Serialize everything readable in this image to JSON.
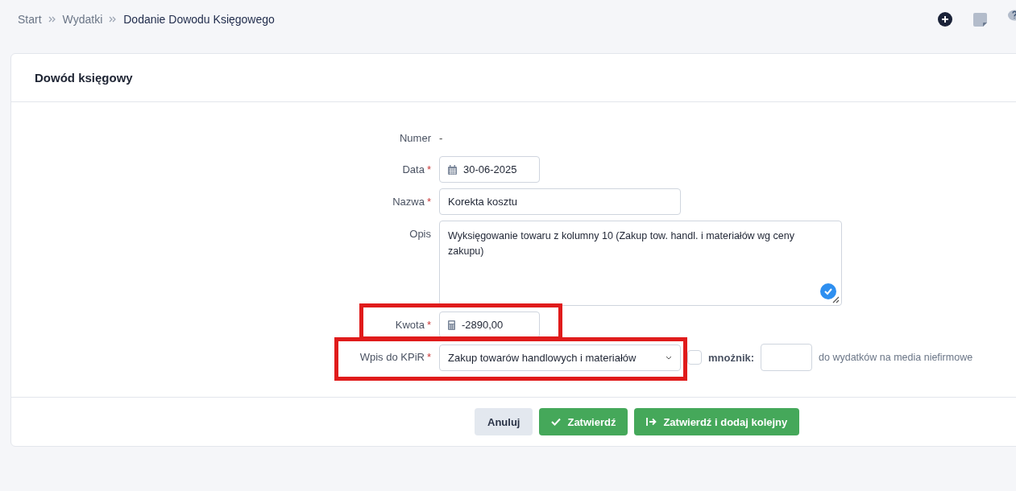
{
  "breadcrumb": [
    {
      "label": "Start",
      "current": false
    },
    {
      "label": "Wydatki",
      "current": false
    },
    {
      "label": "Dodanie Dowodu Księgowego",
      "current": true
    }
  ],
  "card": {
    "title": "Dowód księgowy"
  },
  "form": {
    "required_mark": "*",
    "fields": [
      {
        "kind": "static",
        "label": "Numer",
        "required": false,
        "value": "-",
        "highlighted": false
      },
      {
        "kind": "date",
        "label": "Data",
        "required": true,
        "value": "30-06-2025",
        "highlighted": false
      },
      {
        "kind": "text",
        "label": "Nazwa",
        "required": true,
        "value": "Korekta kosztu",
        "highlighted": false
      },
      {
        "kind": "textarea",
        "label": "Opis",
        "required": false,
        "value": "Wyksięgowanie towaru z kolumny 10 (Zakup tow. handl. i materiałów wg ceny zakupu)",
        "highlighted": false
      },
      {
        "kind": "amount",
        "label": "Kwota",
        "required": true,
        "value": "-2890,00",
        "highlighted": true
      },
      {
        "kind": "select",
        "label": "Wpis do KPiR",
        "required": true,
        "value": "Zakup towarów handlowych i materiałów",
        "highlighted": true,
        "extra": {
          "checked": false,
          "multiplier_label": "mnożnik:",
          "note": "do wydatków na media niefirmowe"
        }
      }
    ]
  },
  "buttons": [
    {
      "kind": "cancel",
      "label": "Anuluj"
    },
    {
      "kind": "confirm",
      "label": "Zatwierdź"
    },
    {
      "kind": "confirm-next",
      "label": "Zatwierdź i dodaj kolejny"
    }
  ]
}
